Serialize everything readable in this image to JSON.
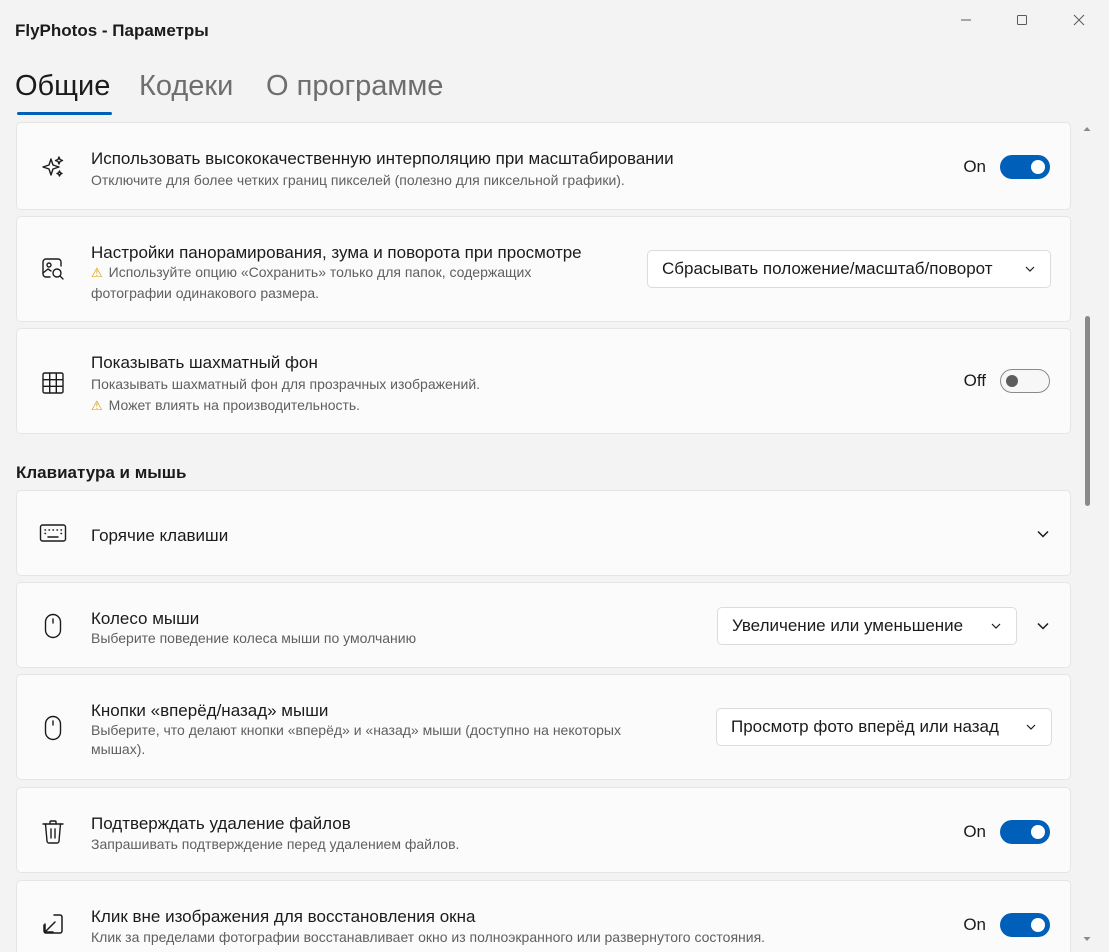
{
  "window": {
    "title": "FlyPhotos - Параметры",
    "controls": [
      "minimize-icon",
      "maximize-icon",
      "close-icon"
    ]
  },
  "tabs": [
    {
      "label": "Общие",
      "active": true
    },
    {
      "label": "Кодеки",
      "active": false
    },
    {
      "label": "О программе",
      "active": false
    }
  ],
  "settings": {
    "interpolation": {
      "title": "Использовать высококачественную интерполяцию при масштабировании",
      "description": "Отключите для более четких границ пикселей (полезно для пиксельной графики).",
      "icon": "sparkle-icon",
      "state_label": "On",
      "enabled": true
    },
    "pan_zoom": {
      "title": "Настройки панорамирования, зума и поворота при просмотре",
      "warning_line1": "Используйте опцию «Сохранить» только для папок, содержащих",
      "warning_line2": "фотографии одинакового размера.",
      "icon": "image-search-icon",
      "selected": "Сбрасывать положение/масштаб/поворот"
    },
    "checkerboard": {
      "title": "Показывать шахматный фон",
      "description": "Показывать шахматный фон для прозрачных изображений.",
      "warning": "Может влиять на производительность.",
      "icon": "grid-icon",
      "state_label": "Off",
      "enabled": false
    }
  },
  "keyboard_mouse": {
    "header": "Клавиатура и мышь",
    "hotkeys": {
      "title": "Горячие клавиши",
      "icon": "keyboard-icon"
    },
    "wheel": {
      "title": "Колесо мыши",
      "description": "Выберите поведение колеса мыши по умолчанию",
      "icon": "mouse-icon",
      "selected": "Увеличение или уменьшение"
    },
    "nav_buttons": {
      "title": "Кнопки «вперёд/назад» мыши",
      "description_line1": "Выберите, что делают кнопки «вперёд» и «назад» мыши (доступно на некоторых",
      "description_line2": "мышах).",
      "icon": "mouse-icon",
      "selected": "Просмотр фото вперёд или назад"
    },
    "confirm_delete": {
      "title": "Подтверждать удаление файлов",
      "description": "Запрашивать подтверждение перед удалением файлов.",
      "icon": "trash-icon",
      "state_label": "On",
      "enabled": true
    },
    "click_outside": {
      "title": "Клик вне изображения для восстановления окна",
      "description": "Клик за пределами фотографии восстанавливает окно из полноэкранного или развернутого состояния.",
      "icon": "arrow-down-left-icon",
      "state_label": "On",
      "enabled": true
    }
  },
  "colors": {
    "accent": "#005fb8",
    "background": "#f3f3f3",
    "card": "#fbfbfb",
    "warning": "#d89c00"
  }
}
